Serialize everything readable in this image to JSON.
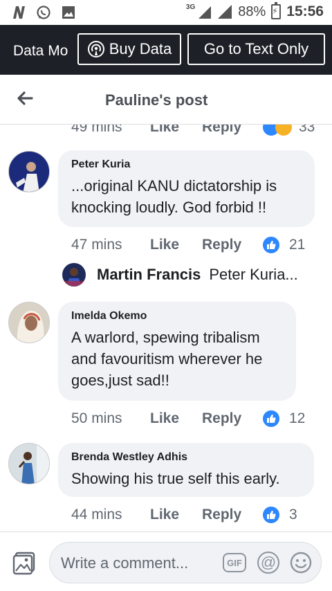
{
  "status_bar": {
    "network_label": "3G",
    "battery": "88%",
    "time": "15:56"
  },
  "data_bar": {
    "mode_label": "Data Mo",
    "buy_data": "Buy Data",
    "text_only": "Go to Text Only"
  },
  "header": {
    "title": "Pauline's post"
  },
  "cut_comment": {
    "time": "49 mins",
    "like": "Like",
    "reply": "Reply",
    "count": "33"
  },
  "comments": [
    {
      "name": "Peter Kuria",
      "text": "...original KANU dictatorship is knocking loudly. God forbid  !!",
      "time": "47 mins",
      "like": "Like",
      "reply": "Reply",
      "count": "21"
    },
    {
      "name": "Imelda Okemo",
      "text": "A warlord, spewing tribalism and favouritism wherever he goes,just sad!!",
      "time": "50 mins",
      "like": "Like",
      "reply": "Reply",
      "count": "12"
    },
    {
      "name": "Brenda Westley Adhis",
      "text": "Showing his true self this early.",
      "time": "44 mins",
      "like": "Like",
      "reply": "Reply",
      "count": "3"
    }
  ],
  "reply_preview": {
    "name": "Martin Francis",
    "text": "Peter Kuria..."
  },
  "composer": {
    "placeholder": "Write a comment...",
    "gif": "GIF",
    "at": "@"
  },
  "colors": {
    "databar_bg": "#1d2127",
    "like_blue": "#2d87ff",
    "bubble_bg": "#f0f2f5"
  }
}
